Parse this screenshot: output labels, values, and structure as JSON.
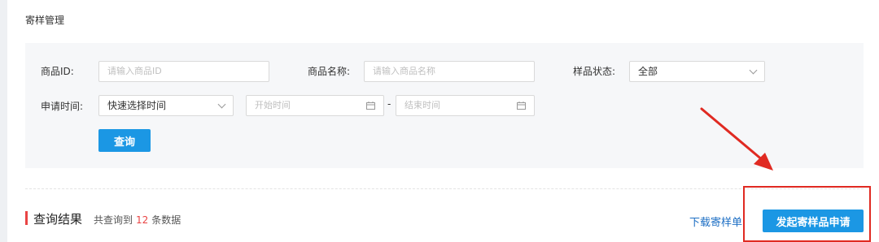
{
  "page": {
    "title": "寄样管理"
  },
  "filters": {
    "product_id": {
      "label": "商品ID:",
      "placeholder": "请输入商品ID"
    },
    "product_name": {
      "label": "商品名称:",
      "placeholder": "请输入商品名称"
    },
    "sample_status": {
      "label": "样品状态:",
      "value": "全部"
    },
    "apply_time": {
      "label": "申请时间:",
      "quick_select": "快速选择时间",
      "start_placeholder": "开始时间",
      "separator": "-",
      "end_placeholder": "结束时间"
    },
    "query_button": "查询"
  },
  "results": {
    "title": "查询结果",
    "count_prefix": "共查询到",
    "count": "12",
    "count_suffix": "条数据",
    "download_link": "下载寄样单",
    "apply_button": "发起寄样品申请"
  },
  "annotation": {
    "color": "#e02a22"
  },
  "colors": {
    "primary": "#1b97e4",
    "accent": "#e94444"
  }
}
